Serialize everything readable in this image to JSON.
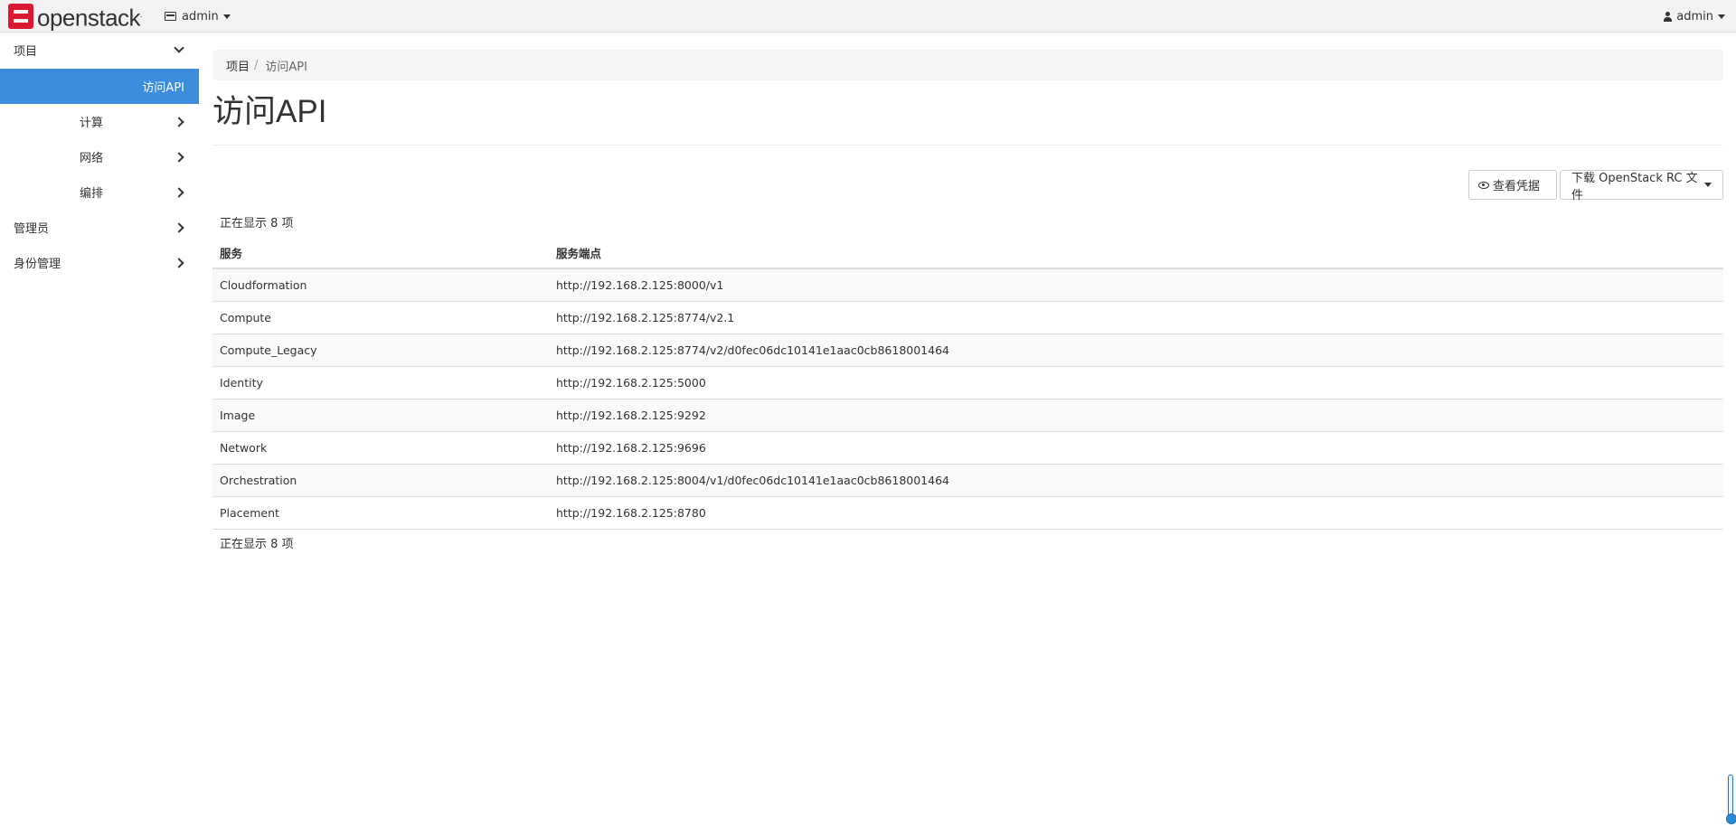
{
  "navbar": {
    "brand": "openstack",
    "brand_mark": ".",
    "project_label": "admin",
    "user_label": "admin"
  },
  "sidebar": {
    "items": [
      {
        "label": "项目"
      },
      {
        "label": "访问API"
      },
      {
        "label": "计算"
      },
      {
        "label": "网络"
      },
      {
        "label": "编排"
      },
      {
        "label": "管理员"
      },
      {
        "label": "身份管理"
      }
    ]
  },
  "breadcrumb": {
    "root": "项目",
    "separator": "/",
    "current": "访问API"
  },
  "page": {
    "title": "访问API"
  },
  "actions": {
    "view_credentials": "查看凭据",
    "download_rc": "下载 OpenStack RC 文件"
  },
  "table": {
    "count_text": "正在显示 8 项",
    "headers": {
      "service": "服务",
      "endpoint": "服务端点"
    },
    "rows": [
      {
        "service": "Cloudformation",
        "endpoint": "http://192.168.2.125:8000/v1"
      },
      {
        "service": "Compute",
        "endpoint": "http://192.168.2.125:8774/v2.1"
      },
      {
        "service": "Compute_Legacy",
        "endpoint": "http://192.168.2.125:8774/v2/d0fec06dc10141e1aac0cb8618001464"
      },
      {
        "service": "Identity",
        "endpoint": "http://192.168.2.125:5000"
      },
      {
        "service": "Image",
        "endpoint": "http://192.168.2.125:9292"
      },
      {
        "service": "Network",
        "endpoint": "http://192.168.2.125:9696"
      },
      {
        "service": "Orchestration",
        "endpoint": "http://192.168.2.125:8004/v1/d0fec06dc10141e1aac0cb8618001464"
      },
      {
        "service": "Placement",
        "endpoint": "http://192.168.2.125:8780"
      }
    ]
  },
  "colors": {
    "accent": "#3c8dde",
    "brand_red": "#da1a32"
  }
}
